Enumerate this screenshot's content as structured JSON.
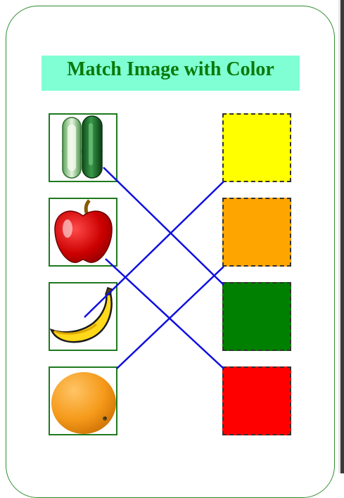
{
  "title": "Match Image with Color",
  "images": [
    {
      "name": "cucumber",
      "icon": "cucumber-icon"
    },
    {
      "name": "apple",
      "icon": "apple-icon"
    },
    {
      "name": "banana",
      "icon": "banana-icon"
    },
    {
      "name": "orange",
      "icon": "orange-icon"
    }
  ],
  "colors": [
    {
      "name": "yellow",
      "hex": "#ffff00"
    },
    {
      "name": "orange",
      "hex": "#ffa500"
    },
    {
      "name": "green",
      "hex": "#008000"
    },
    {
      "name": "red",
      "hex": "#ff0000"
    }
  ],
  "matches": [
    {
      "image": "cucumber",
      "color": "green"
    },
    {
      "image": "apple",
      "color": "red"
    },
    {
      "image": "banana",
      "color": "yellow"
    },
    {
      "image": "orange",
      "color": "orange"
    }
  ],
  "line_color": "#1010e0",
  "accent": "#80ffd4"
}
